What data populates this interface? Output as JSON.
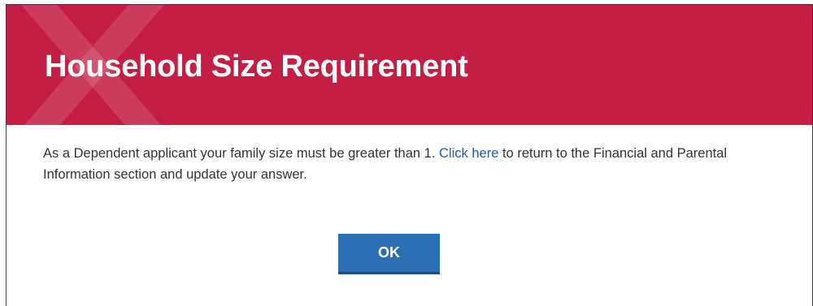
{
  "dialog": {
    "title": "Household Size Requirement",
    "message_before_link": "As a Dependent applicant your family size must be greater than 1. ",
    "link_text": "Click here",
    "message_after_link": " to return to the Financial and Parental Information section and update your answer.",
    "ok_label": "OK"
  },
  "colors": {
    "header_background": "#c41e44",
    "link": "#205fa8",
    "button_background": "#2a6eb3"
  }
}
